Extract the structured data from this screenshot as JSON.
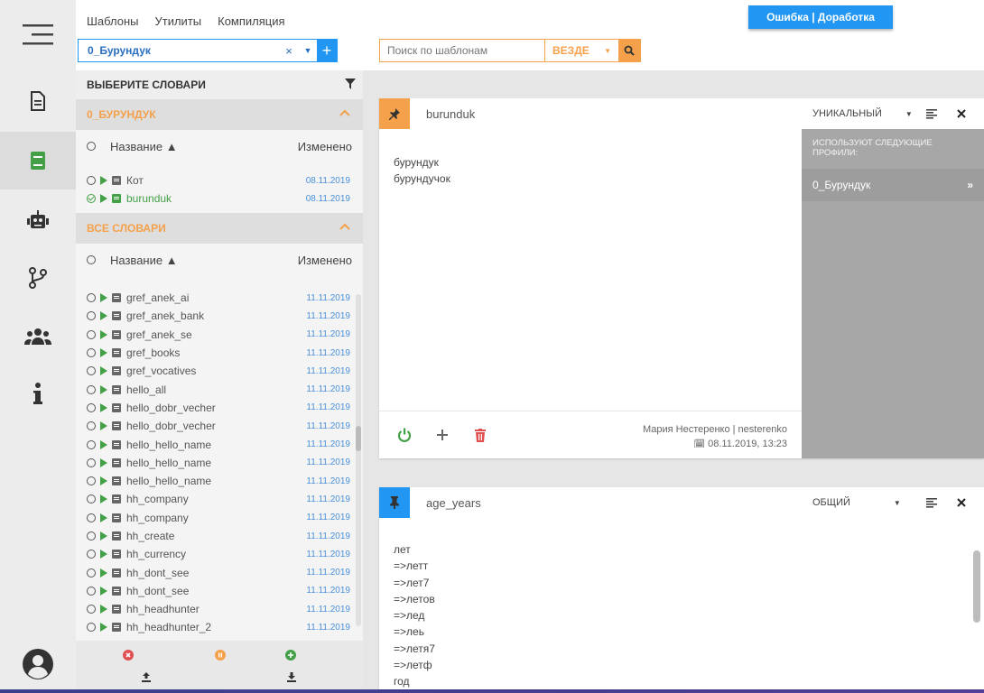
{
  "top_menu": {
    "items": [
      "Шаблоны",
      "Утилиты",
      "Компиляция"
    ]
  },
  "status_button": "Ошибка | Доработка",
  "profile_select": {
    "value": "0_Бурундук",
    "clear": "×",
    "add": "+"
  },
  "search": {
    "placeholder": "Поиск по шаблонам",
    "scope": "ВЕЗДЕ"
  },
  "dict_panel": {
    "title": "ВЫБЕРИТЕ СЛОВАРИ",
    "section1": {
      "title": "0_БУРУНДУК",
      "col_name": "Название ▲",
      "col_modified": "Изменено",
      "rows": [
        {
          "name": "Кот",
          "date": "08.11.2019",
          "checked": false
        },
        {
          "name": "burunduk",
          "date": "08.11.2019",
          "checked": true
        }
      ]
    },
    "section2": {
      "title": "ВСЕ СЛОВАРИ",
      "col_name": "Название ▲",
      "col_modified": "Изменено",
      "rows": [
        {
          "name": "gref_anek_ai",
          "date": "11.11.2019"
        },
        {
          "name": "gref_anek_bank",
          "date": "11.11.2019"
        },
        {
          "name": "gref_anek_se",
          "date": "11.11.2019"
        },
        {
          "name": "gref_books",
          "date": "11.11.2019"
        },
        {
          "name": "gref_vocatives",
          "date": "11.11.2019"
        },
        {
          "name": "hello_all",
          "date": "11.11.2019"
        },
        {
          "name": "hello_dobr_vecher",
          "date": "11.11.2019"
        },
        {
          "name": "hello_dobr_vecher",
          "date": "11.11.2019"
        },
        {
          "name": "hello_hello_name",
          "date": "11.11.2019"
        },
        {
          "name": "hello_hello_name",
          "date": "11.11.2019"
        },
        {
          "name": "hello_hello_name",
          "date": "11.11.2019"
        },
        {
          "name": "hh_company",
          "date": "11.11.2019"
        },
        {
          "name": "hh_company",
          "date": "11.11.2019"
        },
        {
          "name": "hh_create",
          "date": "11.11.2019"
        },
        {
          "name": "hh_currency",
          "date": "11.11.2019"
        },
        {
          "name": "hh_dont_see",
          "date": "11.11.2019"
        },
        {
          "name": "hh_dont_see",
          "date": "11.11.2019"
        },
        {
          "name": "hh_headhunter",
          "date": "11.11.2019"
        },
        {
          "name": "hh_headhunter_2",
          "date": "11.11.2019"
        }
      ]
    }
  },
  "card1": {
    "name": "burunduk",
    "type": "УНИКАЛЬНЫЙ",
    "lines": [
      "бурундук",
      "бурундучок"
    ],
    "side_caption": "ИСПОЛЬЗУЮТ СЛЕДУЮЩИЕ ПРОФИЛИ:",
    "side_profile": "0_Бурундук",
    "author": "Мария Нестеренко | nesterenko",
    "date": "08.11.2019, 13:23"
  },
  "card2": {
    "name": "age_years",
    "type": "ОБЩИЙ",
    "lines": [
      "лет",
      "=>летт",
      "=>лет7",
      "=>летов",
      "=>лед",
      "=>леь",
      "=>летя7",
      "=>летф",
      "год"
    ]
  },
  "colors": {
    "accent_blue": "#2196f3",
    "accent_orange": "#f5a04a",
    "green": "#43a047",
    "red": "#e05050"
  }
}
